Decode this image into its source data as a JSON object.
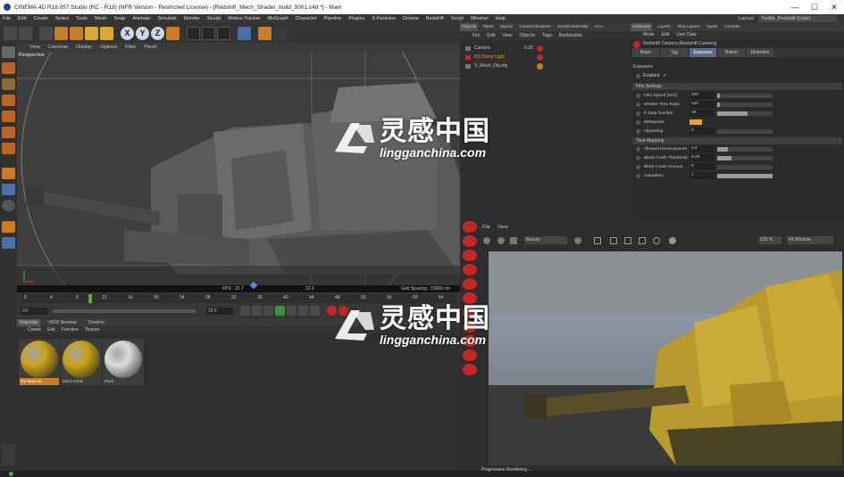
{
  "window": {
    "title": "CINEMA 4D R18.057 Studio (RC - R18) (NFR Version - Restricted License) - [Redshift_Mech_Shader_build_0001.c4d *] - Main",
    "controls": [
      "—",
      "☐",
      "✕"
    ]
  },
  "menubar": {
    "items": [
      "File",
      "Edit",
      "Create",
      "Select",
      "Tools",
      "Mesh",
      "Snap",
      "Animate",
      "Simulate",
      "Render",
      "Sculpt",
      "Motion Tracker",
      "MoGraph",
      "Character",
      "Pipeline",
      "Plugins",
      "X-Particles",
      "Octane",
      "Redshift",
      "Script",
      "Window",
      "Help"
    ],
    "layout_label": "Layout:",
    "layout_value": "Toolkit_Redshift (User)"
  },
  "toolbar": {
    "axis": [
      "X",
      "Y",
      "Z"
    ]
  },
  "viewport": {
    "menu": [
      "View",
      "Cameras",
      "Display",
      "Options",
      "Filter",
      "Panel"
    ],
    "label": "Perspective",
    "fps": "FPS : 22.7",
    "frame": "12 F",
    "grid": "Grid Spacing : 10000 cm"
  },
  "timeline": {
    "ticks": [
      "0",
      "4",
      "8",
      "12",
      "16",
      "20",
      "24",
      "28",
      "32",
      "36",
      "40",
      "44",
      "48",
      "52",
      "56",
      "60",
      "64"
    ],
    "start_field": "0 F",
    "end_field": "72 F",
    "current": "12 F"
  },
  "materials": {
    "tabs": [
      "Materials",
      "HDRI Browser",
      "Timeline"
    ],
    "menu": [
      "Create",
      "Edit",
      "Function",
      "Texture"
    ],
    "items": [
      {
        "label": "RS Material",
        "color": "#c9a21e"
      },
      {
        "label": "Mech Metal",
        "color": "#c8a316"
      },
      {
        "label": "Paint",
        "color": "#dcdcdc"
      }
    ]
  },
  "objects": {
    "tabs": [
      "Objects",
      "Takes",
      "Stucks",
      "Content Browser",
      "Arnold Materials",
      "Ai H"
    ],
    "menu": [
      "File",
      "Edit",
      "View",
      "Objects",
      "Tags",
      "Bookmarks"
    ],
    "rows": [
      {
        "name": "Camera",
        "tag": "0:30"
      },
      {
        "name": "RS Dome Light",
        "tag": ""
      },
      {
        "name": "V_Mech_Obj.obj",
        "tag": ""
      }
    ]
  },
  "attributes": {
    "tabs": [
      "Attributes",
      "Layers",
      "Ren Layers",
      "Xpols",
      "Console"
    ],
    "menu": [
      "Mode",
      "Edit",
      "User Data"
    ],
    "object_title": "Redshift Camera [Redshift Camera]",
    "subtabs": [
      "Basic",
      "Tag",
      "Exposure",
      "Bokeh",
      "Distortion"
    ],
    "active_subtab": "Exposure",
    "section_title": "Exposure",
    "enabled_label": "Enabled",
    "film_section": "Film Settings",
    "film": [
      {
        "label": "Film Speed (ISO)",
        "value": "100",
        "fill": 0.05
      },
      {
        "label": "Shutter Time Ratio",
        "value": "100",
        "fill": 0.05
      },
      {
        "label": "F-Stop Number",
        "value": "16",
        "fill": 0.55
      },
      {
        "label": "Whitepoint",
        "value": "",
        "fill": 0
      },
      {
        "label": "Vignetting",
        "value": "0",
        "fill": 0
      }
    ],
    "tone_section": "Tone Mapping",
    "tone": [
      {
        "label": "Allowed Overexposure",
        "value": "0.2",
        "fill": 0.2
      },
      {
        "label": "Black Crush Threshold",
        "value": "0.25",
        "fill": 0.25
      },
      {
        "label": "Black Crush Amount",
        "value": "0",
        "fill": 0
      },
      {
        "label": "Saturation",
        "value": "1",
        "fill": 1.0
      }
    ],
    "whitepoint_color": "#e8a23a"
  },
  "renderview": {
    "menu": [
      "File",
      "View"
    ],
    "aov": "Beauty",
    "zoom": "125 %",
    "fit": "Fit Window",
    "status": "Progressive Rendering..."
  },
  "watermark": {
    "cn": "灵感中国",
    "en": "lingganchina.com"
  },
  "colors": {
    "accent_orange": "#c97d2a",
    "accent_blue": "#4d6fa7",
    "light_red": "#c22828"
  }
}
